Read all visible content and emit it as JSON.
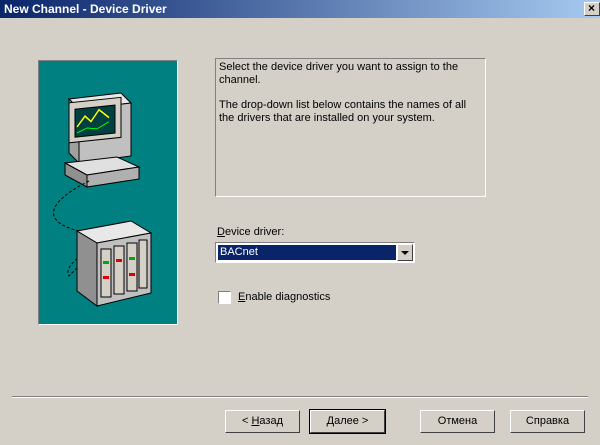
{
  "window": {
    "title": "New Channel - Device Driver",
    "close_glyph": "×"
  },
  "description": {
    "line1": "Select the device driver you want to assign to the channel.",
    "line2": "The drop-down list below contains the names of all the drivers that are installed on your system."
  },
  "device_driver": {
    "label_accel": "D",
    "label_rest": "evice driver:",
    "selected": "BACnet"
  },
  "diagnostics": {
    "label_accel": "E",
    "label_rest": "nable diagnostics",
    "checked": false
  },
  "buttons": {
    "back_prefix": "< ",
    "back_accel": "Н",
    "back_rest": "азад",
    "next_accel": "Д",
    "next_rest": "алее >",
    "cancel": "Отмена",
    "help": "Справка"
  },
  "colors": {
    "title_start": "#0a246a",
    "title_end": "#a6caf0",
    "illustration_bg": "#008080",
    "selection": "#0a246a"
  }
}
